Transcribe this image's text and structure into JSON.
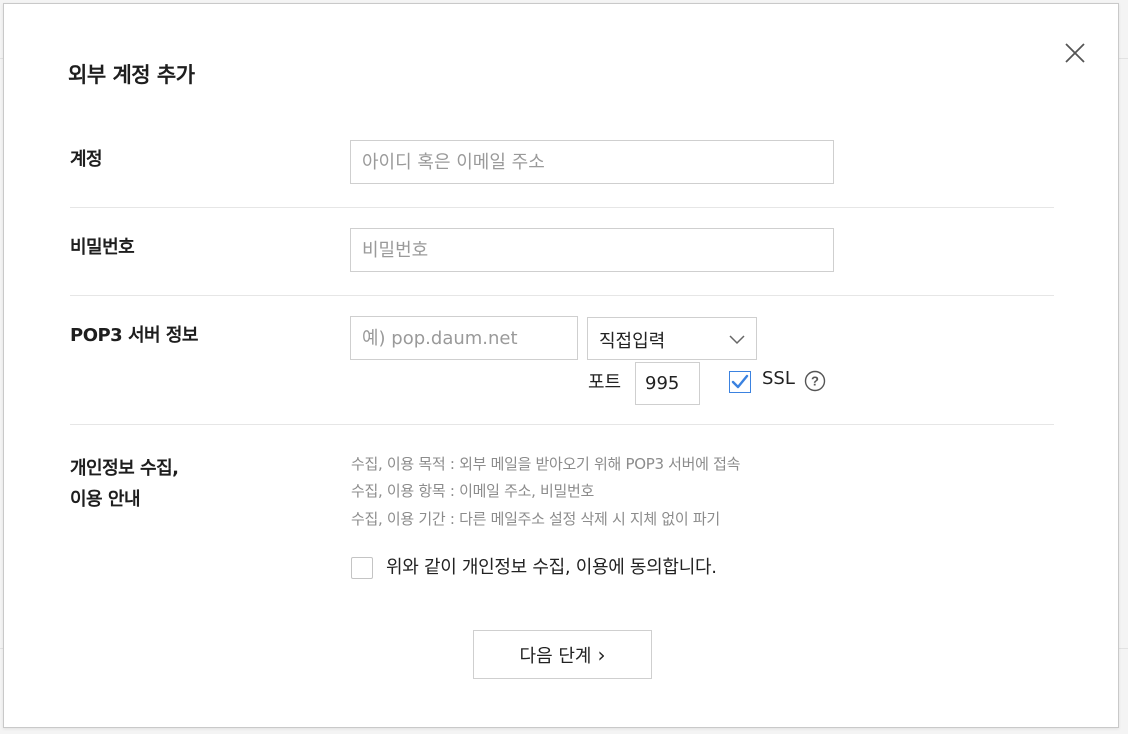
{
  "dialog": {
    "title": "외부 계정 추가",
    "close_icon": "close-icon"
  },
  "account": {
    "label": "계정",
    "placeholder": "아이디 혹은 이메일 주소"
  },
  "password": {
    "label": "비밀번호",
    "placeholder": "비밀번호"
  },
  "pop3": {
    "label": "POP3 서버 정보",
    "server_placeholder": "예) pop.daum.net",
    "server_select": "직접입력",
    "port_label": "포트",
    "port_value": "995",
    "ssl_label": "SSL",
    "ssl_checked": true,
    "help_symbol": "?"
  },
  "privacy": {
    "label_line1": "개인정보 수집,",
    "label_line2": "이용 안내",
    "purpose": "수집, 이용 목적 : 외부 메일을 받아오기 위해 POP3 서버에 접속",
    "items": "수집, 이용 항목 : 이메일 주소, 비밀번호",
    "period": "수집, 이용 기간 : 다른 메일주소 설정 삭제 시 지체 없이 파기",
    "agree_label": "위와 같이 개인정보 수집, 이용에 동의합니다.",
    "agree_checked": false
  },
  "next_button": {
    "label": "다음 단계",
    "arrow": "›"
  },
  "colors": {
    "accent": "#3b82e0",
    "border": "#cfcfcf",
    "muted_text": "#8c8c8c"
  }
}
